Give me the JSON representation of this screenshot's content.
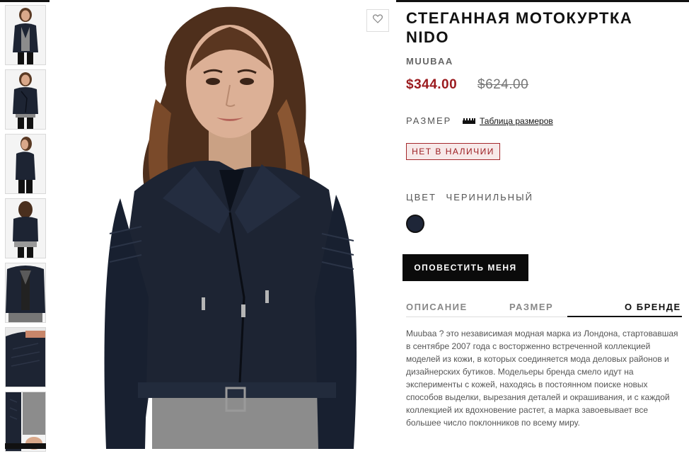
{
  "product": {
    "title": "СТЕГАННАЯ МОТОКУРТКА NIDO",
    "brand": "MUUBAA",
    "price_sale": "$344.00",
    "price_original": "$624.00",
    "size_label": "РАЗМЕР",
    "size_chart_link": "Таблица размеров",
    "stock_status": "НЕТ В НАЛИЧИИ",
    "color_label": "ЦВЕТ",
    "color_value": "ЧЕРИНИЛЬНЫЙ",
    "color_swatch_hex": "#1e2638",
    "notify_button": "ОПОВЕСТИТЬ МЕНЯ"
  },
  "tabs": [
    {
      "label": "ОПИСАНИЕ",
      "active": false
    },
    {
      "label": "РАЗМЕР",
      "active": false
    },
    {
      "label": "О БРЕНДЕ",
      "active": true
    }
  ],
  "brand_description": "Muubaa ? это независимая модная марка из Лондона, стартовавшая в сентябре 2007 года с восторженно встреченной коллекцией моделей из кожи, в которых соединяется мода деловых районов и дизайнерских бутиков. Модельеры бренда смело идут на эксперименты с кожей, находясь в постоянном поиске новых способов выделки, вырезания деталей и окрашивания, и с каждой коллекцией их вдохновение растет, а марка завоевывает все большее число поклонников по всему миру.",
  "icons": {
    "wishlist": "heart-icon",
    "size_chart": "ruler-icon"
  },
  "colors": {
    "sale_price": "#9b1b1f",
    "accent_dark": "#0b0b0b"
  }
}
